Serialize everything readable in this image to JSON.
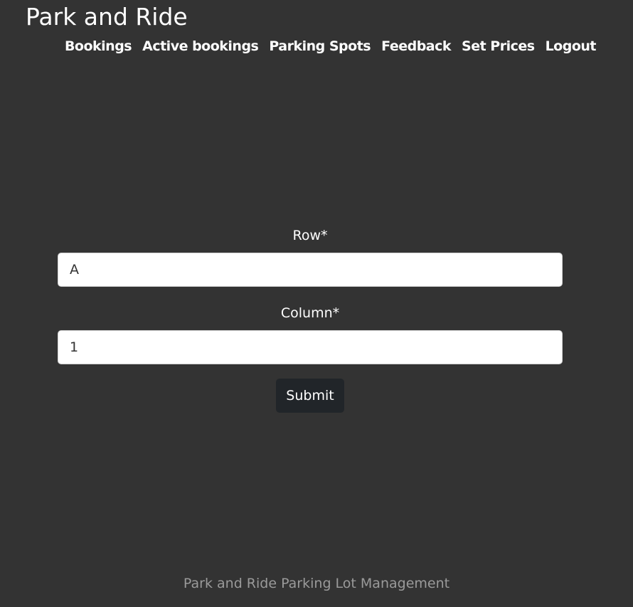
{
  "header": {
    "title": "Park and Ride"
  },
  "nav": {
    "items": [
      {
        "label": "Bookings"
      },
      {
        "label": "Active bookings"
      },
      {
        "label": "Parking Spots"
      },
      {
        "label": "Feedback"
      },
      {
        "label": "Set Prices"
      },
      {
        "label": "Logout"
      }
    ]
  },
  "form": {
    "row_label": "Row*",
    "row_value": "A",
    "column_label": "Column*",
    "column_value": "1",
    "submit_label": "Submit"
  },
  "footer": {
    "text": "Park and Ride Parking Lot Management"
  },
  "colors": {
    "background": "#333333",
    "button": "#212529",
    "footer_text": "#9a9a9a"
  }
}
